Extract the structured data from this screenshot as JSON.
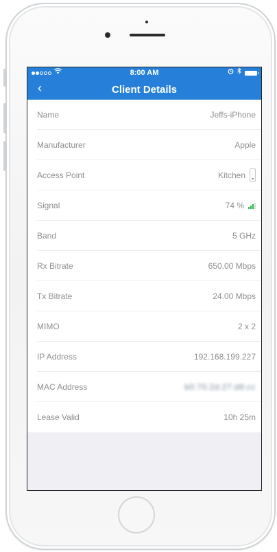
{
  "status_bar": {
    "time": "8:00 AM"
  },
  "nav": {
    "back_glyph": "‹",
    "title": "Client Details"
  },
  "details": [
    {
      "label": "Name",
      "value": "Jeffs-iPhone"
    },
    {
      "label": "Manufacturer",
      "value": "Apple"
    },
    {
      "label": "Access Point",
      "value": "Kitchen"
    },
    {
      "label": "Signal",
      "value": "74 %"
    },
    {
      "label": "Band",
      "value": "5 GHz"
    },
    {
      "label": "Rx Bitrate",
      "value": "650.00 Mbps"
    },
    {
      "label": "Tx Bitrate",
      "value": "24.00 Mbps"
    },
    {
      "label": "MIMO",
      "value": "2 x 2"
    },
    {
      "label": "IP Address",
      "value": "192.168.199.227"
    },
    {
      "label": "MAC Address",
      "value": "b0:70:2d:27:d8:cc"
    },
    {
      "label": "Lease Valid",
      "value": "10h 25m"
    }
  ],
  "colors": {
    "header": "#2680d9",
    "screen_background": "#efeff4",
    "text_secondary": "#8e8e93",
    "signal_green": "#2bb34a"
  },
  "icons": {
    "wifi": "wifi-icon",
    "alarm": "alarm-icon",
    "bluetooth": "bluetooth-icon",
    "battery": "battery-icon",
    "access_point": "access-point-icon",
    "signal": "signal-bars-icon"
  }
}
